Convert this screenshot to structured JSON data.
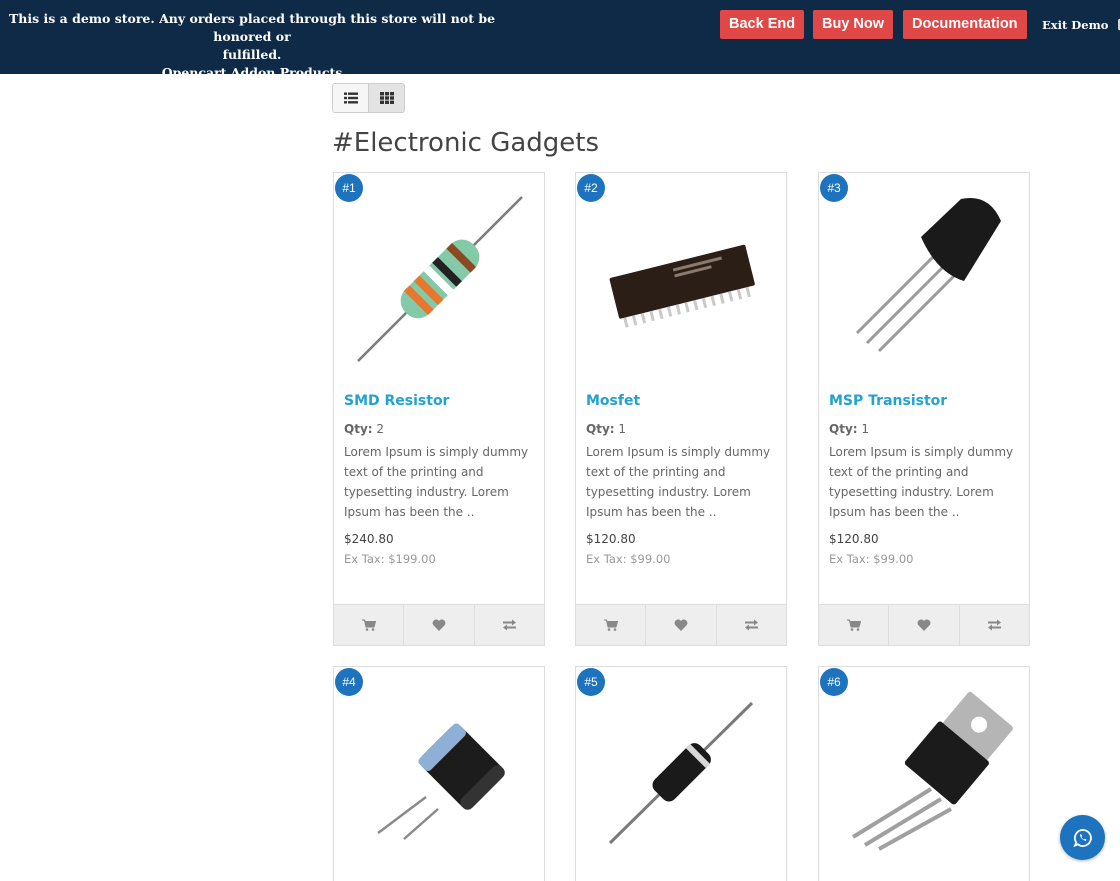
{
  "banner": {
    "line1": "This is a demo store. Any orders placed through this store will not be honored or",
    "line2": "fulfilled.",
    "line3": "Opencart Addon Products",
    "buttons": [
      "Back End",
      "Buy Now",
      "Documentation"
    ],
    "exit_label": "Exit Demo"
  },
  "category_title": "#Electronic Gadgets",
  "qty_label": "Qty:",
  "products": [
    {
      "badge": "#1",
      "name": "SMD Resistor",
      "qty": "2",
      "desc": "Lorem Ipsum is simply dummy text of the printing and typesetting industry. Lorem Ipsum has been the ..",
      "price": "$240.80",
      "ex_tax": "Ex Tax: $199.00"
    },
    {
      "badge": "#2",
      "name": "Mosfet",
      "qty": "1",
      "desc": "Lorem Ipsum is simply dummy text of the printing and typesetting industry. Lorem Ipsum has been the ..",
      "price": "$120.80",
      "ex_tax": "Ex Tax: $99.00"
    },
    {
      "badge": "#3",
      "name": "MSP Transistor",
      "qty": "1",
      "desc": "Lorem Ipsum is simply dummy text of the printing and typesetting industry. Lorem Ipsum has been the ..",
      "price": "$120.80",
      "ex_tax": "Ex Tax: $99.00"
    },
    {
      "badge": "#4"
    },
    {
      "badge": "#5"
    },
    {
      "badge": "#6"
    }
  ],
  "colors": {
    "banner_bg": "#0e2a47",
    "demo_button": "#e04848",
    "badge": "#1e73be",
    "product_link": "#23a1d1"
  },
  "icons": {
    "list_view": "list-icon",
    "grid_view": "grid-icon",
    "cart": "shopping-cart-icon",
    "wishlist": "heart-icon",
    "compare": "exchange-icon",
    "exit": "sign-out-icon",
    "chat": "whatsapp-icon"
  }
}
